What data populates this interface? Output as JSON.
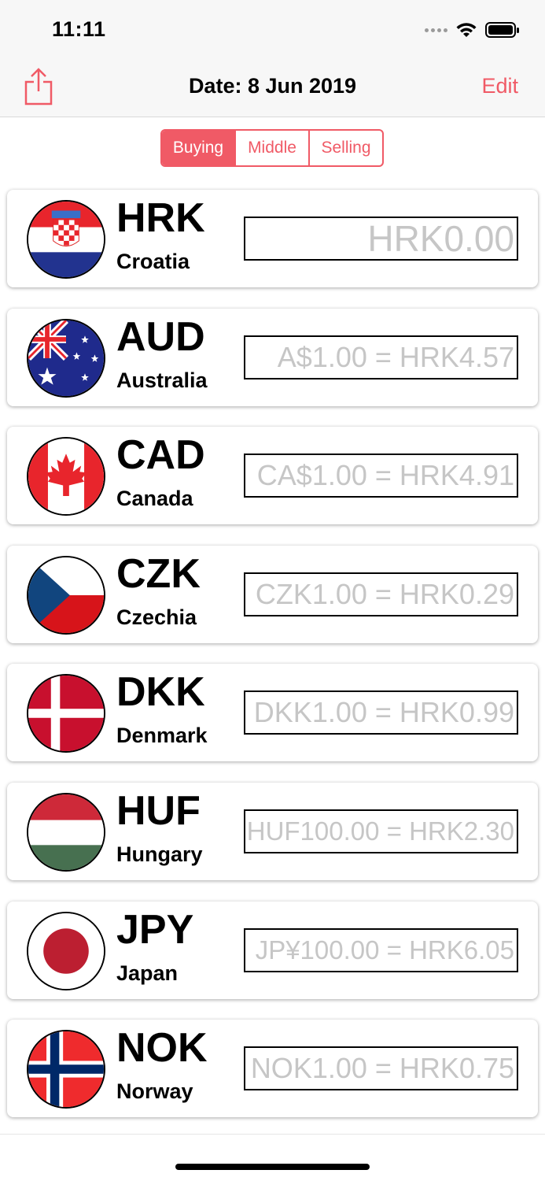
{
  "status_bar": {
    "time": "11:11"
  },
  "nav": {
    "title": "Date: 8 Jun 2019",
    "edit_label": "Edit"
  },
  "segments": [
    {
      "label": "Buying",
      "active": true
    },
    {
      "label": "Middle",
      "active": false
    },
    {
      "label": "Selling",
      "active": false
    }
  ],
  "currencies": [
    {
      "code": "HRK",
      "country": "Croatia",
      "rate": "HRK0.00",
      "flag": "croatia-flag-icon"
    },
    {
      "code": "AUD",
      "country": "Australia",
      "rate": "A$1.00 = HRK4.57",
      "flag": "australia-flag-icon"
    },
    {
      "code": "CAD",
      "country": "Canada",
      "rate": "CA$1.00 = HRK4.91",
      "flag": "canada-flag-icon"
    },
    {
      "code": "CZK",
      "country": "Czechia",
      "rate": "CZK1.00 = HRK0.29",
      "flag": "czechia-flag-icon"
    },
    {
      "code": "DKK",
      "country": "Denmark",
      "rate": "DKK1.00 = HRK0.99",
      "flag": "denmark-flag-icon"
    },
    {
      "code": "HUF",
      "country": "Hungary",
      "rate": "HUF100.00 = HRK2.30",
      "flag": "hungary-flag-icon"
    },
    {
      "code": "JPY",
      "country": "Japan",
      "rate": "JP¥100.00 = HRK6.05",
      "flag": "japan-flag-icon"
    },
    {
      "code": "NOK",
      "country": "Norway",
      "rate": "NOK1.00 = HRK0.75",
      "flag": "norway-flag-icon"
    }
  ],
  "colors": {
    "accent": "#f05a66",
    "placeholder": "#c6c6c6"
  }
}
